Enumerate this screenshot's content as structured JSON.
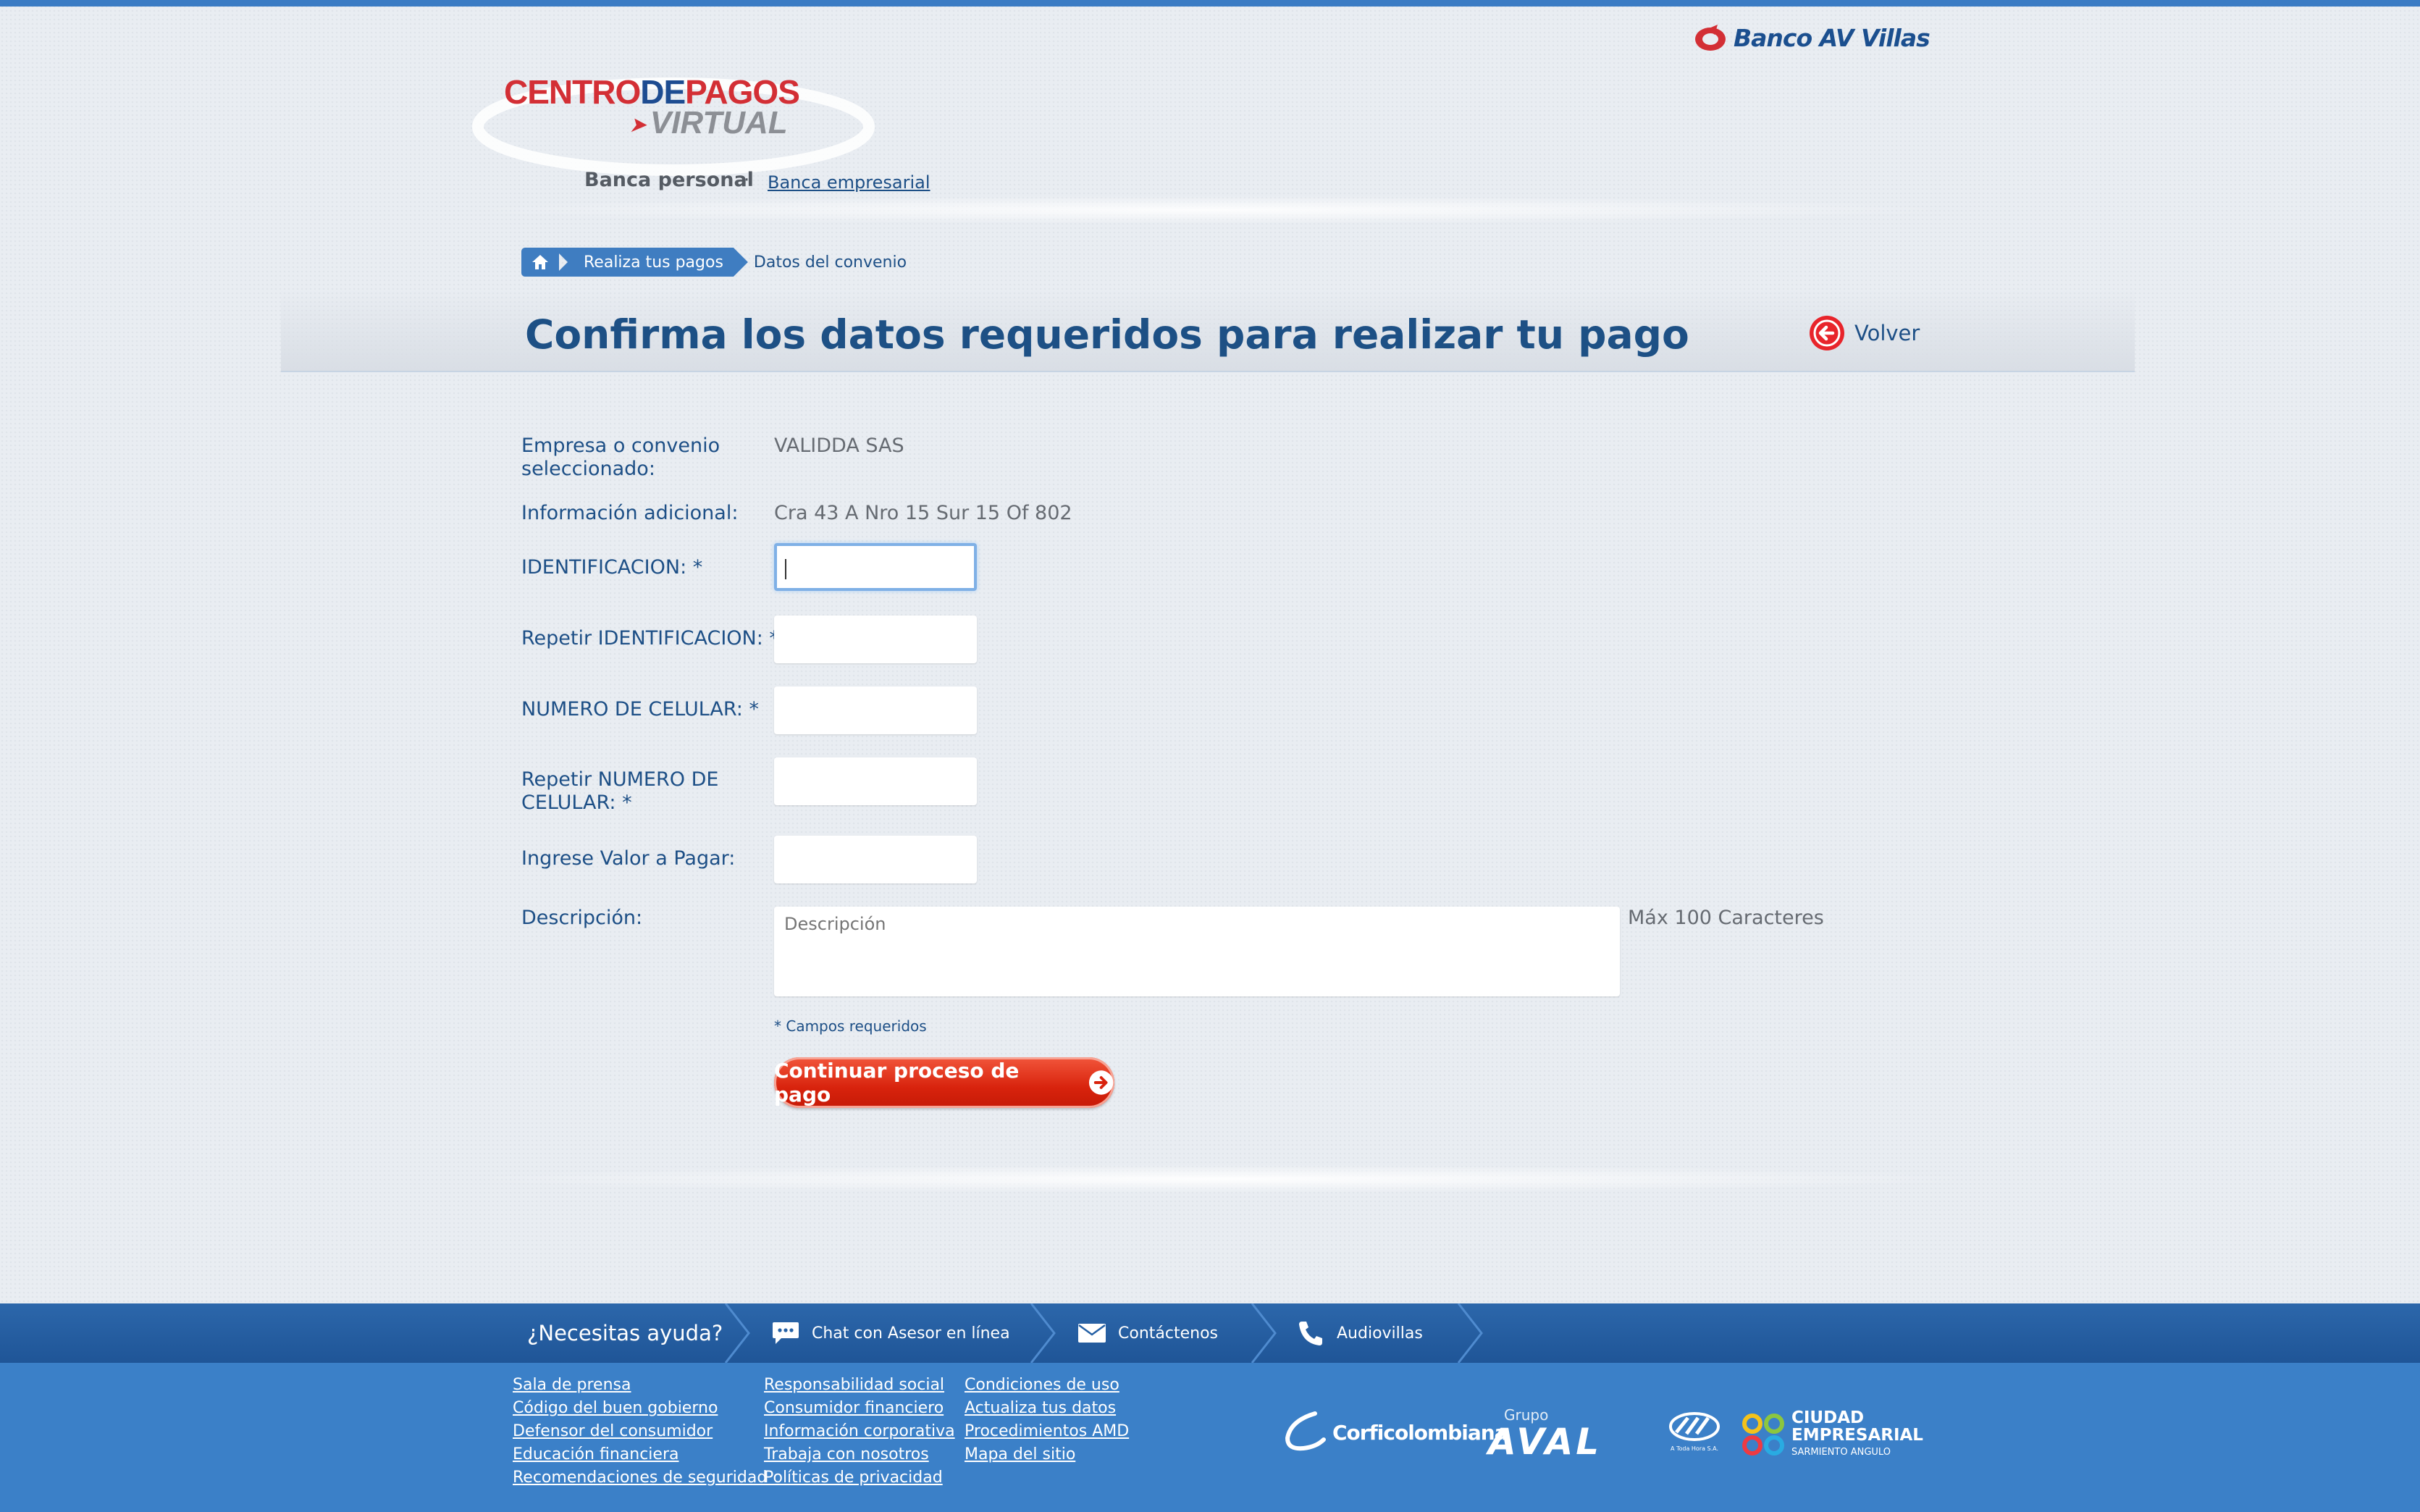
{
  "header": {
    "bank_name": "Banco AV Villas",
    "logo": {
      "line1_a": "CENTRO",
      "line1_b": "DE",
      "line1_c": "PAGOS",
      "line2": "VIRTUAL"
    },
    "nav": {
      "personal": "Banca personal",
      "separator": "·",
      "empresarial": "Banca empresarial"
    }
  },
  "breadcrumb": {
    "home_icon": "home-icon",
    "step1": "Realiza tus pagos",
    "current": "Datos del convenio"
  },
  "page": {
    "title": "Confirma los datos requeridos para realizar tu pago",
    "back_label": "Volver"
  },
  "form": {
    "empresa_label": "Empresa o convenio seleccionado:",
    "empresa_value": "VALIDDA SAS",
    "info_label": "Información adicional:",
    "info_value": "Cra 43 A Nro 15 Sur 15 Of 802",
    "identificacion_label": "IDENTIFICACION: *",
    "identificacion_value": "",
    "repetir_identificacion_label": "Repetir IDENTIFICACION: *",
    "repetir_identificacion_value": "",
    "celular_label": "NUMERO DE CELULAR: *",
    "celular_value": "",
    "repetir_celular_label": "Repetir NUMERO DE CELULAR: *",
    "repetir_celular_value": "",
    "valor_label": "Ingrese Valor a Pagar:",
    "valor_value": "",
    "descripcion_label": "Descripción:",
    "descripcion_placeholder": "Descripción",
    "max_chars": "Máx 100 Caracteres",
    "required_note": "* Campos requeridos",
    "submit_label": "Continuar proceso de pago"
  },
  "help_bar": {
    "title": "¿Necesitas ayuda?",
    "chat": "Chat con Asesor en línea",
    "contact": "Contáctenos",
    "audio": "Audiovillas"
  },
  "footer": {
    "col1": [
      "Sala de prensa",
      "Código del buen gobierno",
      "Defensor del consumidor",
      "Educación financiera",
      "Recomendaciones de seguridad"
    ],
    "col2": [
      "Responsabilidad social",
      "Consumidor financiero",
      "Información corporativa",
      "Trabaja con nosotros",
      "Políticas de privacidad"
    ],
    "col3": [
      "Condiciones de uso",
      "Actualiza tus datos",
      "Procedimientos AMD",
      "Mapa del sitio"
    ],
    "partners": {
      "corficolombiana": "Corficolombiana",
      "grupo": "Grupo",
      "aval": "AVAL",
      "atuservicio": "A Toda Hora S.A.",
      "ciudad1": "CIUDAD",
      "ciudad2": "EMPRESARIAL",
      "ciudad3": "SARMIENTO ANGULO"
    }
  },
  "colors": {
    "accent": "#1d4f86",
    "brand_red": "#d32f35",
    "button_red": "#d8230d",
    "footer_blue": "#3b80c8"
  }
}
